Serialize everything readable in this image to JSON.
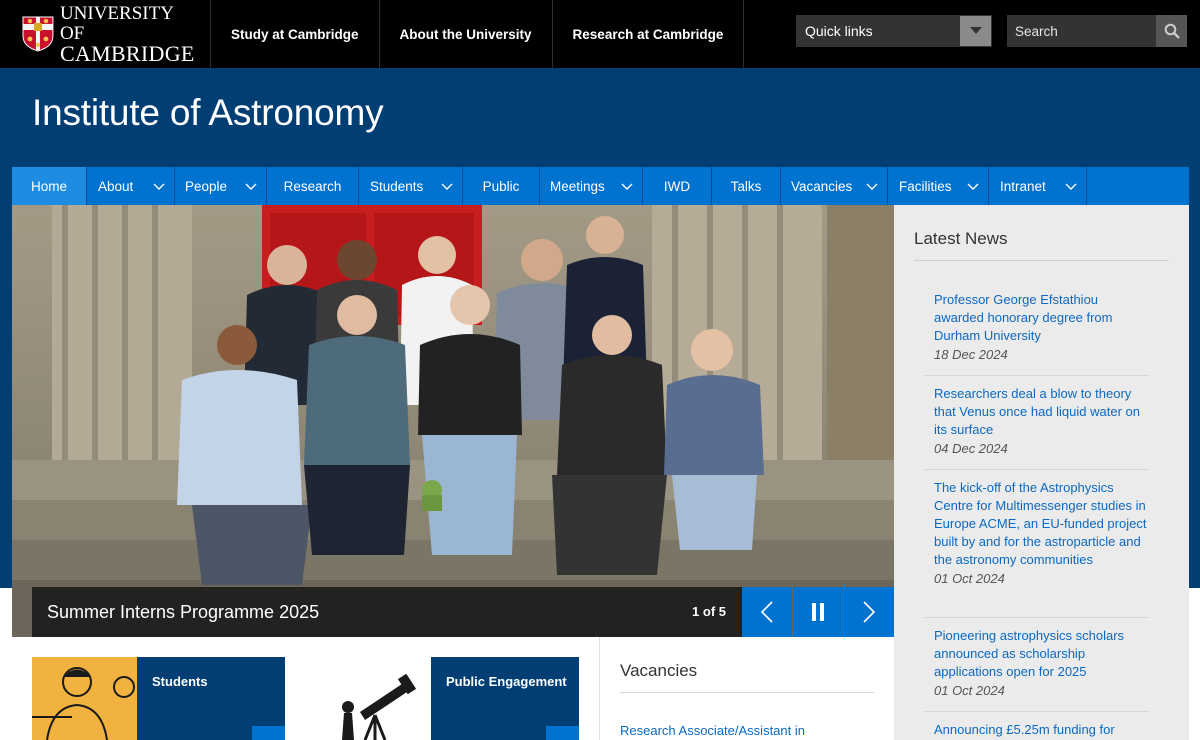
{
  "brand": {
    "line1": "UNIVERSITY OF",
    "line2": "CAMBRIDGE"
  },
  "topnav": [
    {
      "label": "Study at Cambridge"
    },
    {
      "label": "About the University"
    },
    {
      "label": "Research at Cambridge"
    }
  ],
  "quicklinks": {
    "label": "Quick links"
  },
  "search": {
    "placeholder": "Search"
  },
  "site": {
    "title": "Institute of Astronomy"
  },
  "mainnav": [
    {
      "label": "Home",
      "active": true,
      "dropdown": false
    },
    {
      "label": "About",
      "dropdown": true
    },
    {
      "label": "People",
      "dropdown": true
    },
    {
      "label": "Research",
      "dropdown": false
    },
    {
      "label": "Students",
      "dropdown": true
    },
    {
      "label": "Public",
      "dropdown": false
    },
    {
      "label": "Meetings",
      "dropdown": true
    },
    {
      "label": "IWD",
      "dropdown": false
    },
    {
      "label": "Talks",
      "dropdown": false
    },
    {
      "label": "Vacancies",
      "dropdown": true
    },
    {
      "label": "Facilities",
      "dropdown": true
    },
    {
      "label": "Intranet",
      "dropdown": true
    }
  ],
  "carousel": {
    "caption": "Summer Interns Programme 2025",
    "counter": "1 of 5"
  },
  "news": {
    "title": "Latest News",
    "items": [
      {
        "text": "Professor George Efstathiou awarded honorary degree from Durham University",
        "date": "18 Dec 2024"
      },
      {
        "text": "Researchers deal a blow to theory that Venus once had liquid water on its surface",
        "date": "04 Dec 2024"
      },
      {
        "text": "The kick-off of the Astrophysics Centre for Multimessenger studies in Europe ACME, an EU-funded project built by and for the astroparticle and the astronomy communities",
        "date": "01 Oct 2024"
      },
      {
        "text": "Pioneering astrophysics scholars announced as scholarship applications open for 2025",
        "date": "01 Oct 2024"
      },
      {
        "text": "Announcing £5.25m funding for",
        "date": ""
      }
    ]
  },
  "tiles": [
    {
      "label": "Students"
    },
    {
      "label": "Public Engagement"
    }
  ],
  "vacancies": {
    "title": "Vacancies",
    "first": "Research Associate/Assistant in"
  },
  "colors": {
    "cambridge_blue_dark": "#003e74",
    "nav_blue": "#0072cf",
    "link_blue": "#0c69c1"
  }
}
